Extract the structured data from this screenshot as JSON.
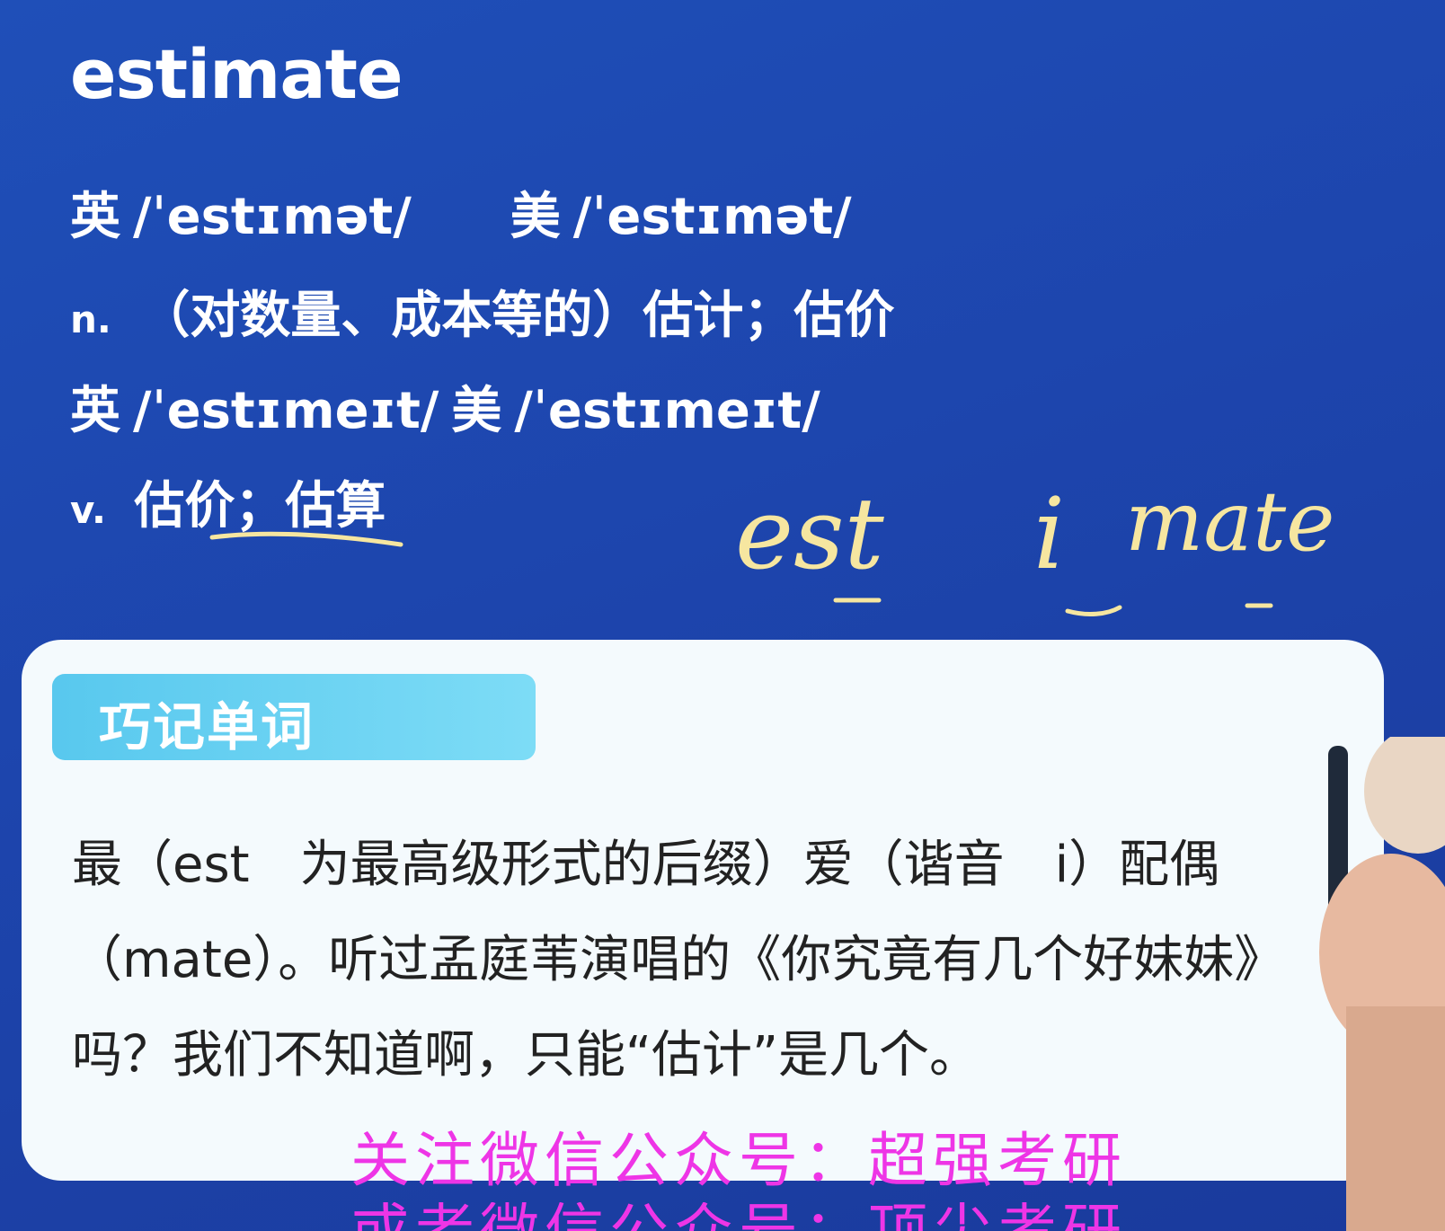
{
  "word": "estimate",
  "pronunciations_1": {
    "uk_label": "英",
    "uk_ipa": "/ˈestɪmət/",
    "us_label": "美",
    "us_ipa": "/ˈestɪmət/"
  },
  "definition_noun": {
    "pos": "n.",
    "text": "（对数量、成本等的）估计；估价"
  },
  "pronunciations_2": {
    "uk_label": "英",
    "uk_ipa": "/ˈestɪmeɪt/",
    "us_label": "美",
    "us_ipa": "/ˈestɪmeɪt/"
  },
  "definition_verb": {
    "pos": "v.",
    "text": "估价；估算"
  },
  "handwriting": {
    "part1": "est",
    "part2": "i",
    "part3": "mate",
    "ink_color": "#f6e6a0"
  },
  "memory_card": {
    "badge": "巧记单词",
    "text": "最（est　为最高级形式的后缀）爱（谐音　i）配偶（mate）。听过孟庭苇演唱的《你究竟有几个好妹妹》吗？我们不知道啊，只能“估计”是几个。"
  },
  "watermark": {
    "line1": "关注微信公众号：超强考研",
    "line2": "或者微信公众号：顶尖考研",
    "color": "#ee35e6"
  }
}
